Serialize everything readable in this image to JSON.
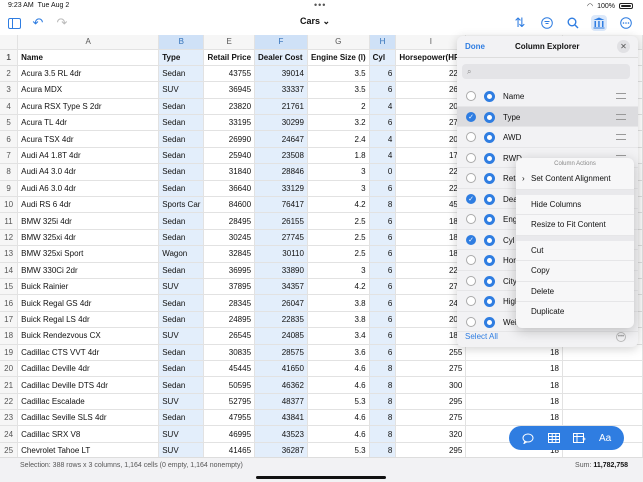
{
  "status_bar": {
    "time": "9:23 AM",
    "date": "Tue Aug 2",
    "battery": "100%"
  },
  "toolbar": {
    "title": "Cars",
    "icons": [
      "sidebar-icon",
      "undo-icon",
      "redo-icon",
      "sort-icon",
      "filter-icon",
      "search-icon",
      "columns-icon",
      "more-icon"
    ]
  },
  "columns": [
    "",
    "A",
    "B",
    "E",
    "F",
    "G",
    "H",
    "I"
  ],
  "header_row": [
    "Name",
    "Type",
    "Retail Price",
    "Dealer Cost",
    "Engine Size (l)",
    "Cyl",
    "Horsepower(HP)"
  ],
  "rows": [
    [
      "2",
      "Acura 3.5 RL 4dr",
      "Sedan",
      "43755",
      "39014",
      "3.5",
      "6",
      "225"
    ],
    [
      "3",
      "Acura MDX",
      "SUV",
      "36945",
      "33337",
      "3.5",
      "6",
      "265"
    ],
    [
      "4",
      "Acura RSX Type S 2dr",
      "Sedan",
      "23820",
      "21761",
      "2",
      "4",
      "200"
    ],
    [
      "5",
      "Acura TL 4dr",
      "Sedan",
      "33195",
      "30299",
      "3.2",
      "6",
      "270"
    ],
    [
      "6",
      "Acura TSX 4dr",
      "Sedan",
      "26990",
      "24647",
      "2.4",
      "4",
      "200"
    ],
    [
      "7",
      "Audi A4 1.8T 4dr",
      "Sedan",
      "25940",
      "23508",
      "1.8",
      "4",
      "170"
    ],
    [
      "8",
      "Audi A4 3.0 4dr",
      "Sedan",
      "31840",
      "28846",
      "3",
      "0",
      "220"
    ],
    [
      "9",
      "Audi A6 3.0 4dr",
      "Sedan",
      "36640",
      "33129",
      "3",
      "6",
      "220"
    ],
    [
      "10",
      "Audi RS 6 4dr",
      "Sports Car",
      "84600",
      "76417",
      "4.2",
      "8",
      "450"
    ],
    [
      "11",
      "BMW 325i 4dr",
      "Sedan",
      "28495",
      "26155",
      "2.5",
      "6",
      "184"
    ],
    [
      "12",
      "BMW 325xi 4dr",
      "Sedan",
      "30245",
      "27745",
      "2.5",
      "6",
      "184"
    ],
    [
      "13",
      "BMW 325xi Sport",
      "Wagon",
      "32845",
      "30110",
      "2.5",
      "6",
      "184"
    ],
    [
      "14",
      "BMW 330Ci 2dr",
      "Sedan",
      "36995",
      "33890",
      "3",
      "6",
      "225"
    ],
    [
      "15",
      "Buick Rainier",
      "SUV",
      "37895",
      "34357",
      "4.2",
      "6",
      "275"
    ],
    [
      "16",
      "Buick Regal GS 4dr",
      "Sedan",
      "28345",
      "26047",
      "3.8",
      "6",
      "240"
    ],
    [
      "17",
      "Buick Regal LS 4dr",
      "Sedan",
      "24895",
      "22835",
      "3.8",
      "6",
      "200"
    ],
    [
      "18",
      "Buick Rendezvous CX",
      "SUV",
      "26545",
      "24085",
      "3.4",
      "6",
      "185"
    ],
    [
      "19",
      "Cadillac CTS VVT 4dr",
      "Sedan",
      "30835",
      "28575",
      "3.6",
      "6",
      "255"
    ],
    [
      "20",
      "Cadillac Deville 4dr",
      "Sedan",
      "45445",
      "41650",
      "4.6",
      "8",
      "275"
    ],
    [
      "21",
      "Cadillac Deville DTS 4dr",
      "Sedan",
      "50595",
      "46362",
      "4.6",
      "8",
      "300"
    ],
    [
      "22",
      "Cadillac Escalade",
      "SUV",
      "52795",
      "48377",
      "5.3",
      "8",
      "295"
    ],
    [
      "23",
      "Cadillac Seville SLS 4dr",
      "Sedan",
      "47955",
      "43841",
      "4.6",
      "8",
      "275"
    ],
    [
      "24",
      "Cadillac SRX V8",
      "SUV",
      "46995",
      "43523",
      "4.6",
      "8",
      "320"
    ],
    [
      "25",
      "Chevrolet Tahoe LT",
      "SUV",
      "41465",
      "36287",
      "5.3",
      "8",
      "295"
    ]
  ],
  "partial_col_values": [
    "18",
    "18",
    "18",
    "18",
    "18",
    "18",
    "18"
  ],
  "column_explorer": {
    "done_label": "Done",
    "title": "Column Explorer",
    "search_placeholder": "",
    "items": [
      {
        "label": "Name",
        "checked": false
      },
      {
        "label": "Type",
        "checked": true
      },
      {
        "label": "AWD",
        "checked": false
      },
      {
        "label": "RWD",
        "checked": false
      },
      {
        "label": "Reta",
        "checked": false
      },
      {
        "label": "Dea",
        "checked": true
      },
      {
        "label": "Eng",
        "checked": false
      },
      {
        "label": "Cyl",
        "checked": true
      },
      {
        "label": "Hor",
        "checked": false
      },
      {
        "label": "City",
        "checked": false
      },
      {
        "label": "High",
        "checked": false
      },
      {
        "label": "Weig",
        "checked": false
      }
    ],
    "select_all_label": "Select All"
  },
  "context_menu": {
    "title": "Column Actions",
    "items_a": [
      "Set Content Alignment"
    ],
    "items_b": [
      "Hide Columns",
      "Resize to Fit Content"
    ],
    "items_c": [
      "Cut",
      "Copy",
      "Delete",
      "Duplicate"
    ]
  },
  "float_toolbar": [
    "comment-icon",
    "table-icon",
    "insert-table-icon",
    "text-format-icon"
  ],
  "float_toolbar_aa": "Aa",
  "bottom_bar": {
    "selection_text": "Selection: 388 rows x 3 columns, 1,164 cells (0 empty, 1,164 nonempty)",
    "sum_label": "Sum:",
    "sum_value": "11,782,758"
  },
  "colors": {
    "accent": "#2f7de1",
    "selection": "#e3eefb"
  }
}
